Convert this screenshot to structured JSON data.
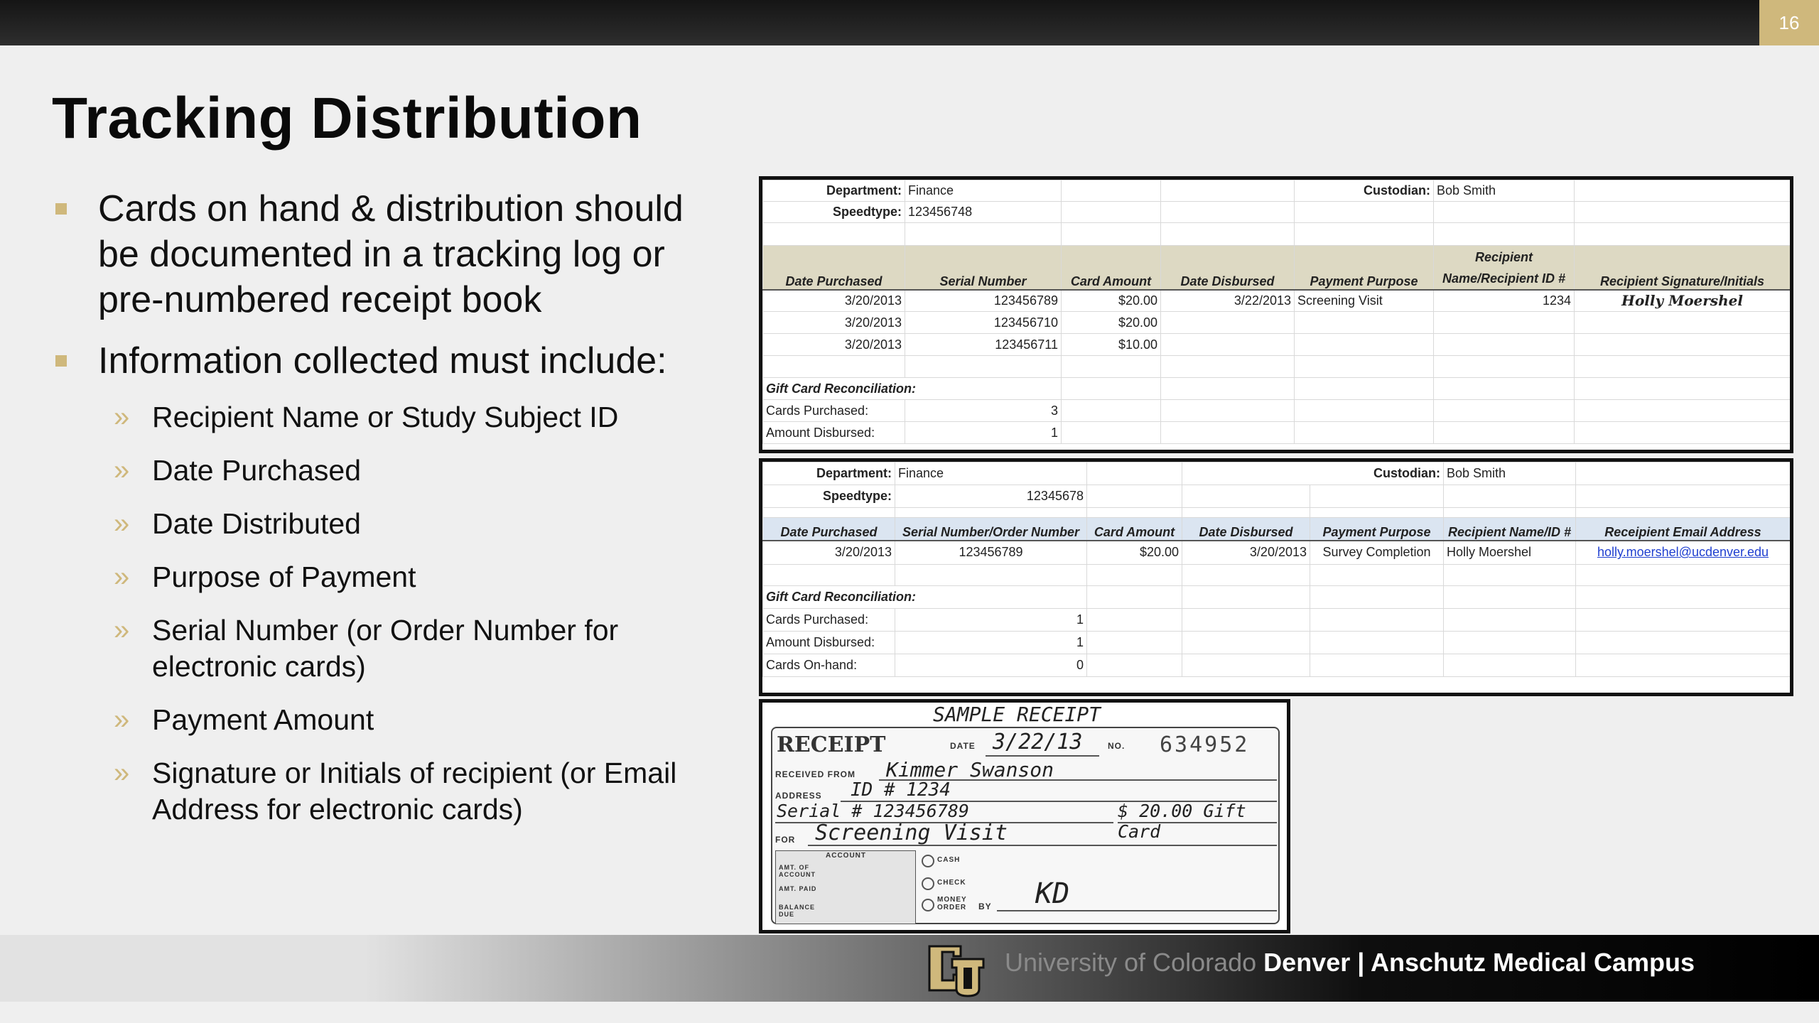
{
  "page_number": "16",
  "title": "Tracking Distribution",
  "bullets": [
    "Cards on hand & distribution should be documented in a tracking log or pre-numbered receipt book",
    "Information collected must include:"
  ],
  "subbullets": [
    "Recipient Name or Study Subject ID",
    "Date Purchased",
    "Date Distributed",
    "Purpose of Payment",
    "Serial Number (or Order Number for electronic cards)",
    "Payment Amount",
    "Signature or Initials of recipient (or Email Address for electronic cards)"
  ],
  "log1": {
    "department_label": "Department:",
    "department": "Finance",
    "speedtype_label": "Speedtype:",
    "speedtype": "123456748",
    "custodian_label": "Custodian:",
    "custodian": "Bob Smith",
    "headers": [
      "Date Purchased",
      "Serial Number",
      "Card Amount",
      "Date Disbursed",
      "Payment Purpose",
      "Recipient Name/Recipient ID #",
      "Recipient Signature/Initials"
    ],
    "header_recipient_top": "Recipient",
    "header_recipient_bottom": "Name/Recipient ID #",
    "rows": [
      [
        "3/20/2013",
        "123456789",
        "$20.00",
        "3/22/2013",
        "Screening Visit",
        "1234",
        "Holly Moershel"
      ],
      [
        "3/20/2013",
        "123456710",
        "$20.00",
        "",
        "",
        "",
        ""
      ],
      [
        "3/20/2013",
        "123456711",
        "$10.00",
        "",
        "",
        "",
        ""
      ]
    ],
    "recon_title": "Gift Card Reconciliation:",
    "recon": [
      {
        "label": "Cards Purchased:",
        "value": "3"
      },
      {
        "label": "Amount Disbursed:",
        "value": "1"
      }
    ]
  },
  "log2": {
    "department_label": "Department:",
    "department": "Finance",
    "speedtype_label": "Speedtype:",
    "speedtype": "12345678",
    "custodian_label": "Custodian:",
    "custodian": "Bob Smith",
    "headers": [
      "Date Purchased",
      "Serial Number/Order Number",
      "Card Amount",
      "Date Disbursed",
      "Payment Purpose",
      "Recipient Name/ID #",
      "Receipient Email Address"
    ],
    "row": [
      "3/20/2013",
      "123456789",
      "$20.00",
      "3/20/2013",
      "Survey Completion",
      "Holly Moershel",
      "holly.moershel@ucdenver.edu"
    ],
    "recon_title": "Gift Card Reconciliation:",
    "recon": [
      {
        "label": "Cards Purchased:",
        "value": "1"
      },
      {
        "label": "Amount Disbursed:",
        "value": "1"
      },
      {
        "label": "Cards On-hand:",
        "value": "0"
      }
    ]
  },
  "receipt": {
    "sample": "SAMPLE RECEIPT",
    "receipt_label": "RECEIPT",
    "date_label": "DATE",
    "date": "3/22/13",
    "no_label": "NO.",
    "number": "634952",
    "received_from_label": "RECEIVED FROM",
    "received_from": "Kimmer Swanson",
    "address_label": "ADDRESS",
    "address": "ID # 1234",
    "serial": "Serial # 123456789",
    "amount": "$ 20.00 Gift Card",
    "for_label": "FOR",
    "for": "Screening Visit",
    "account_label": "ACCOUNT",
    "account_rows": [
      "AMT. OF ACCOUNT",
      "AMT. PAID",
      "BALANCE DUE"
    ],
    "options": [
      "CASH",
      "CHECK",
      "MONEY ORDER"
    ],
    "by_label": "BY",
    "signature": "KD"
  },
  "footer": {
    "university_light": "University of Colorado",
    "university_bold": "Denver | Anschutz Medical Campus"
  },
  "colors": {
    "gold": "#cfb87c",
    "header1_bg": "#ddd9c3",
    "header2_bg": "#dbe5f1",
    "link": "#1f3fd0"
  }
}
